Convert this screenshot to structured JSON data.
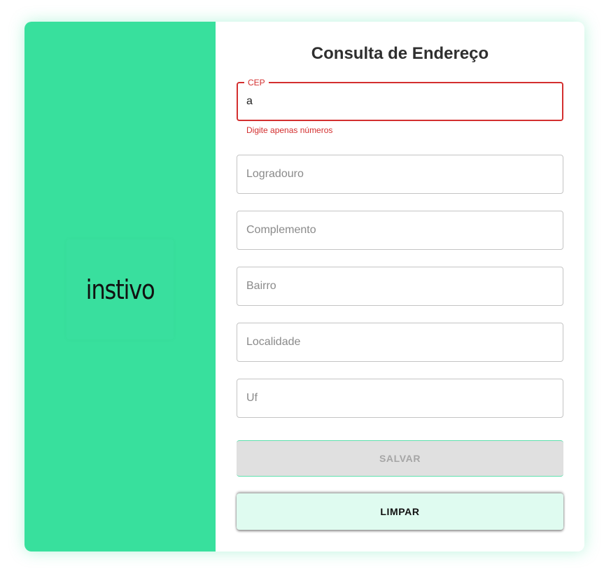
{
  "logo": {
    "text": "instivo"
  },
  "form": {
    "title": "Consulta de Endereço",
    "cep": {
      "label": "CEP",
      "value": "a",
      "error": "Digite apenas números"
    },
    "logradouro": {
      "placeholder": "Logradouro",
      "value": ""
    },
    "complemento": {
      "placeholder": "Complemento",
      "value": ""
    },
    "bairro": {
      "placeholder": "Bairro",
      "value": ""
    },
    "localidade": {
      "placeholder": "Localidade",
      "value": ""
    },
    "uf": {
      "placeholder": "Uf",
      "value": ""
    },
    "save_label": "SALVAR",
    "clear_label": "LIMPAR"
  },
  "colors": {
    "brand": "#38e09d",
    "error": "#d32f2f",
    "clear_button_bg": "#dffbf0",
    "disabled_button_bg": "#e0e0e0"
  }
}
